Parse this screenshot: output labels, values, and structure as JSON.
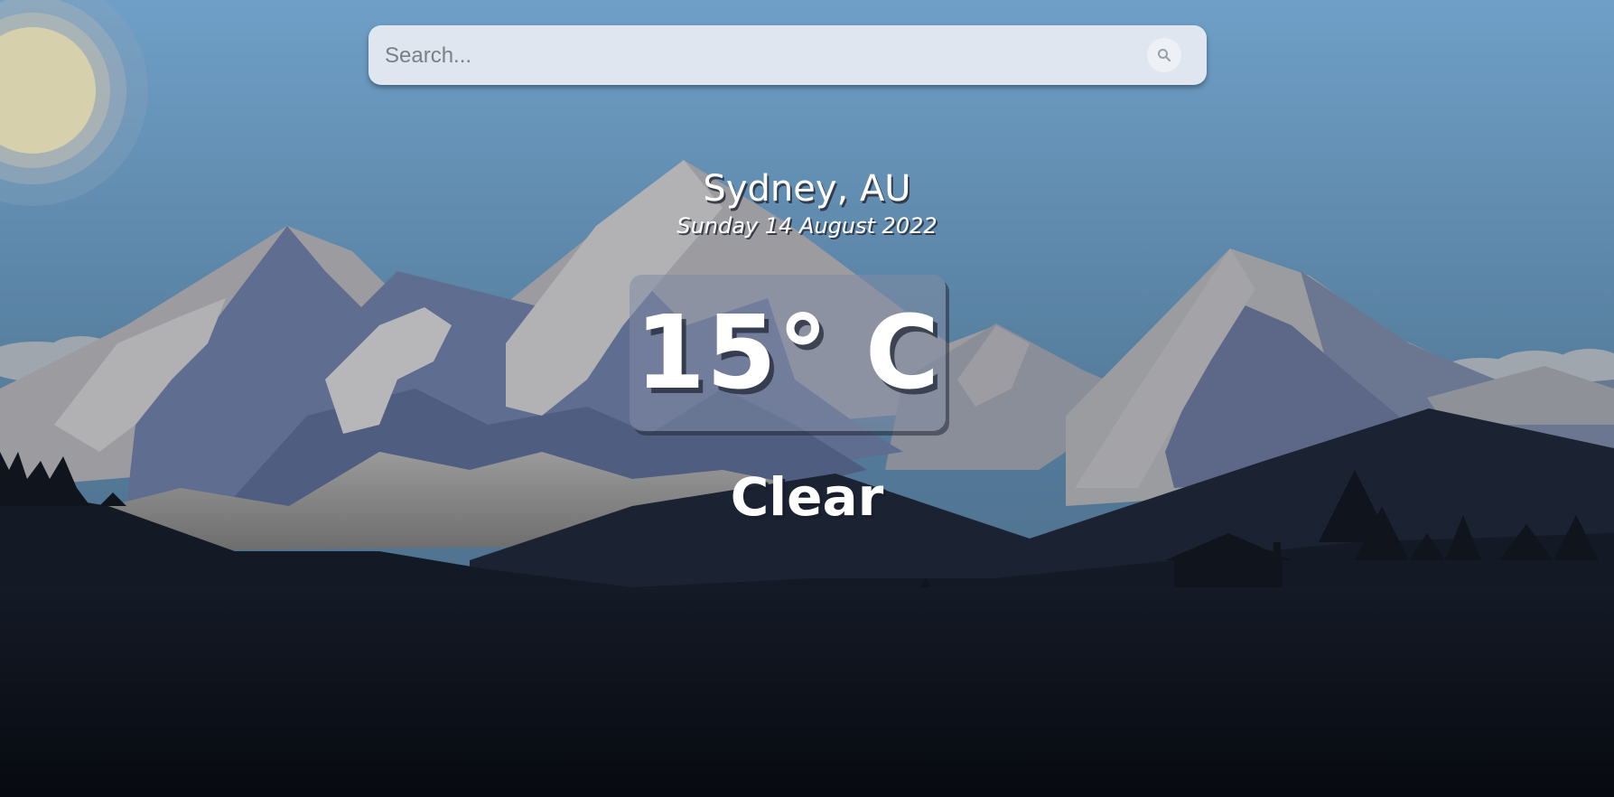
{
  "search": {
    "placeholder": "Search..."
  },
  "weather": {
    "location": "Sydney, AU",
    "date": "Sunday 14 August 2022",
    "temperature": "15° C",
    "condition": "Clear"
  },
  "icons": {
    "search_button": "search-icon",
    "celestial": "sun-icon"
  },
  "colors": {
    "sky_top": "#6d9fc6",
    "sky_bottom": "#4e6e8b",
    "snow": "#a7a7a7",
    "rock": "#5d6c8e",
    "far_hills": "#1c2332",
    "foreground": "#090d14",
    "search_bg": "#dfe6ef",
    "text": "#ffffff"
  }
}
